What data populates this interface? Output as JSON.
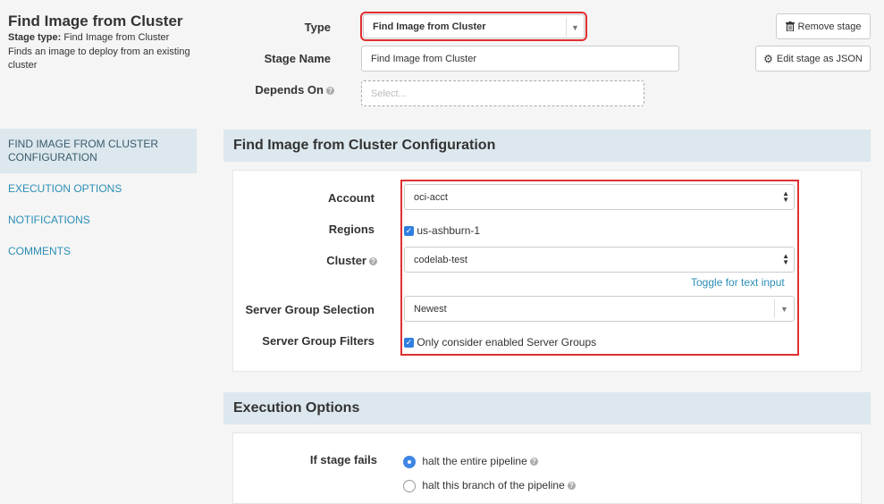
{
  "header": {
    "title": "Find Image from Cluster",
    "stage_type_label": "Stage type:",
    "stage_type_value": "Find Image from Cluster",
    "description": "Finds an image to deploy from an existing cluster"
  },
  "stage_form": {
    "type_label": "Type",
    "type_value": "Find Image from Cluster",
    "name_label": "Stage Name",
    "name_value": "Find Image from Cluster",
    "depends_label": "Depends On",
    "depends_placeholder": "Select..."
  },
  "buttons": {
    "remove": "Remove stage",
    "edit_json": "Edit stage as JSON"
  },
  "sidebar": {
    "items": [
      {
        "label": "FIND IMAGE FROM CLUSTER CONFIGURATION"
      },
      {
        "label": "EXECUTION OPTIONS"
      },
      {
        "label": "NOTIFICATIONS"
      },
      {
        "label": "COMMENTS"
      }
    ]
  },
  "config": {
    "heading": "Find Image from Cluster Configuration",
    "account_label": "Account",
    "account_value": "oci-acct",
    "regions_label": "Regions",
    "region_value": "us-ashburn-1",
    "cluster_label": "Cluster",
    "cluster_value": "codelab-test",
    "toggle_link": "Toggle for text input",
    "sg_selection_label": "Server Group Selection",
    "sg_selection_value": "Newest",
    "sg_filters_label": "Server Group Filters",
    "sg_filters_value": "Only consider enabled Server Groups"
  },
  "execution": {
    "heading": "Execution Options",
    "if_fails_label": "If stage fails",
    "option_halt_pipeline": "halt the entire pipeline",
    "option_halt_branch": "halt this branch of the pipeline"
  },
  "colors": {
    "accent": "#2b8eb5",
    "highlight": "#e02f2f",
    "section_bg": "#dce8ee",
    "checkbox": "#2f7fe0"
  }
}
